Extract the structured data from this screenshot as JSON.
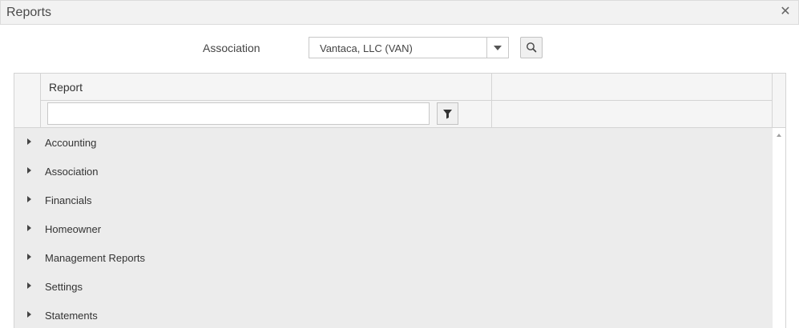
{
  "window": {
    "title": "Reports",
    "close_icon": "close-icon"
  },
  "association": {
    "label": "Association",
    "selected": "Vantaca, LLC (VAN)",
    "dropdown_icon": "chevron-down-icon",
    "search_icon": "search-icon"
  },
  "grid": {
    "column_header": "Report",
    "filter_value": "",
    "filter_icon": "filter-icon",
    "rows": [
      {
        "label": "Accounting"
      },
      {
        "label": "Association"
      },
      {
        "label": "Financials"
      },
      {
        "label": "Homeowner"
      },
      {
        "label": "Management Reports"
      },
      {
        "label": "Settings"
      },
      {
        "label": "Statements"
      }
    ],
    "expander_icon": "caret-right-icon",
    "scroll_up_icon": "scroll-up-arrow-icon"
  }
}
